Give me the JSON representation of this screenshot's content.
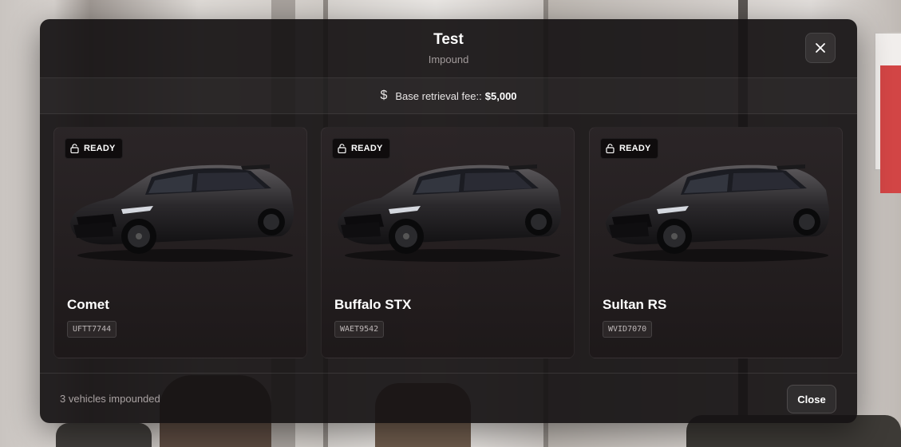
{
  "modal": {
    "title": "Test",
    "subtitle": "Impound"
  },
  "fee": {
    "icon": "dollar-icon",
    "label": "Base retrieval fee::",
    "value": "$5,000"
  },
  "vehicles": [
    {
      "status": "READY",
      "name": "Comet",
      "plate": "UFTT7744",
      "icon": "lock-open-icon"
    },
    {
      "status": "READY",
      "name": "Buffalo STX",
      "plate": "WAET9542",
      "icon": "lock-open-icon"
    },
    {
      "status": "READY",
      "name": "Sultan RS",
      "plate": "WVID7070",
      "icon": "lock-open-icon"
    }
  ],
  "footer": {
    "count_text": "3 vehicles impounded",
    "close_label": "Close"
  },
  "colors": {
    "modal_bg": "#16121a",
    "accent_text": "#ffffff",
    "muted_text": "#a29b9b"
  }
}
